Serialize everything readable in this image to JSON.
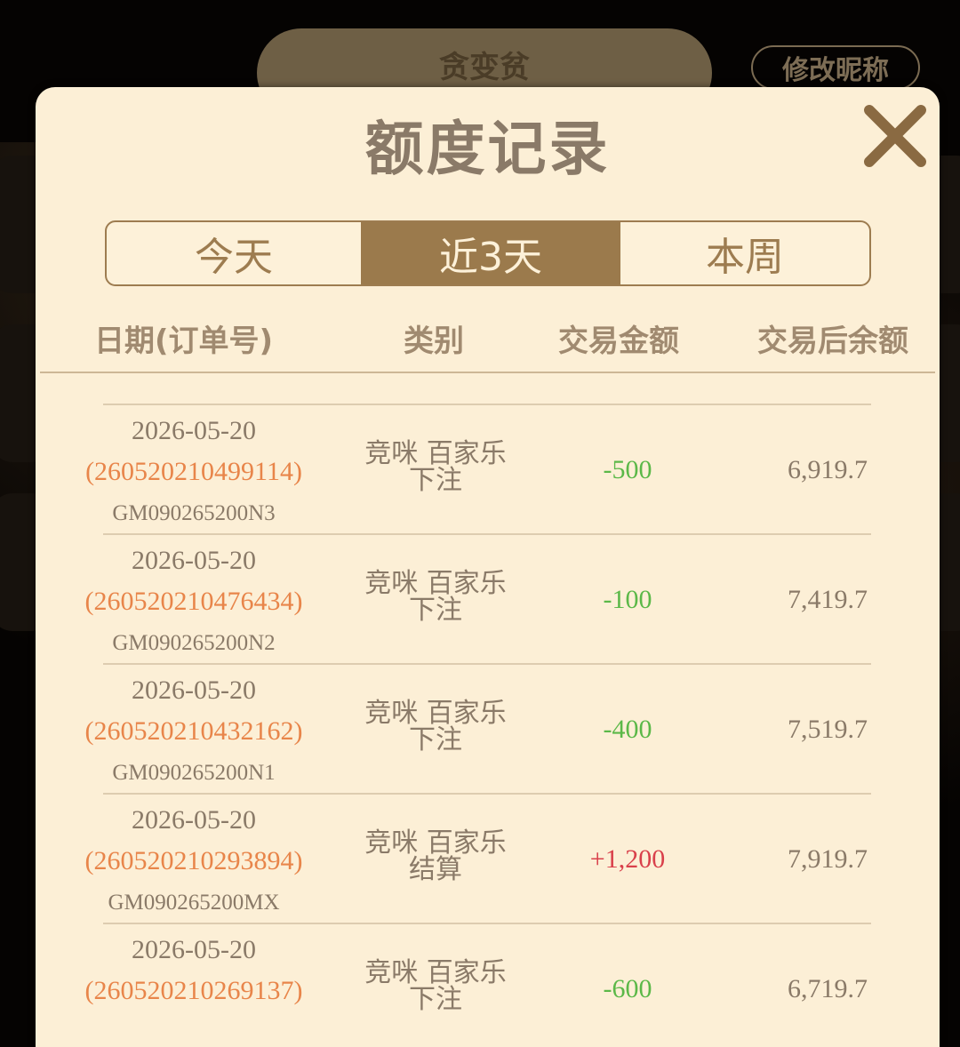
{
  "background": {
    "player_name": "贪变贫",
    "nickname_button": "修改昵称"
  },
  "modal": {
    "title": "额度记录",
    "close_icon": "close-x-icon",
    "tabs": [
      {
        "label": "今天",
        "active": false
      },
      {
        "label": "近3天",
        "active": true
      },
      {
        "label": "本周",
        "active": false
      }
    ],
    "columns": [
      "日期(订单号)",
      "类别",
      "交易金额",
      "交易后余额"
    ],
    "colors": {
      "negative": "#5bb848",
      "positive": "#d9404b",
      "order": "#e8854a",
      "accent": "#9b7a4c"
    },
    "rows": [
      {
        "date": "2026-05-20",
        "order": "(260520210499114)",
        "gm": "GM090265200N3",
        "cat1": "竞咪 百家乐",
        "cat2": "下注",
        "amount": "-500",
        "sign": "negative",
        "balance": "6,919.7"
      },
      {
        "date": "2026-05-20",
        "order": "(260520210476434)",
        "gm": "GM090265200N2",
        "cat1": "竞咪 百家乐",
        "cat2": "下注",
        "amount": "-100",
        "sign": "negative",
        "balance": "7,419.7"
      },
      {
        "date": "2026-05-20",
        "order": "(260520210432162)",
        "gm": "GM090265200N1",
        "cat1": "竞咪 百家乐",
        "cat2": "下注",
        "amount": "-400",
        "sign": "negative",
        "balance": "7,519.7"
      },
      {
        "date": "2026-05-20",
        "order": "(260520210293894)",
        "gm": "GM090265200MX",
        "cat1": "竞咪 百家乐",
        "cat2": "结算",
        "amount": "+1,200",
        "sign": "positive",
        "balance": "7,919.7"
      },
      {
        "date": "2026-05-20",
        "order": "(260520210269137)",
        "gm": "",
        "cat1": "竞咪 百家乐",
        "cat2": "下注",
        "amount": "-600",
        "sign": "negative",
        "balance": "6,719.7"
      }
    ]
  }
}
